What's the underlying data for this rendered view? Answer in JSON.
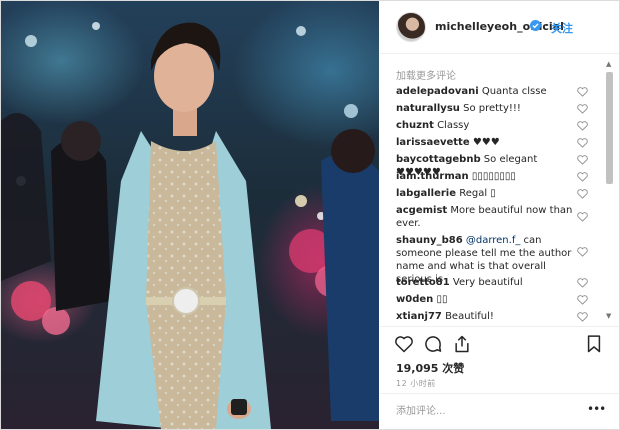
{
  "post": {
    "username": "michelleyeoh_official",
    "follow_label": "关注",
    "verified_color": "#3897f0"
  },
  "comments": {
    "load_more": "加载更多评论",
    "items": [
      {
        "user": "adelepadovani",
        "text": "Quanta clsse"
      },
      {
        "user": "naturallysu",
        "text": "So pretty!!!"
      },
      {
        "user": "chuznt",
        "text": "Classy"
      },
      {
        "user": "larissaevette",
        "text": "♥♥♥"
      },
      {
        "user": "baycottagebnb",
        "text": "So elegant ♥♥♥♥♥"
      },
      {
        "user": "iam.thurman",
        "text": "▯▯▯▯▯▯▯▯"
      },
      {
        "user": "labgallerie",
        "text": "Regal ▯"
      },
      {
        "user": "acgemist",
        "text": "More beautiful now than ever."
      },
      {
        "user": "shauny_b86",
        "mention": "@darren.f_",
        "text": "can someone please tell me the author name and what is that overall serious is"
      },
      {
        "user": "toretto81",
        "text": "Very beautiful"
      },
      {
        "user": "w0den",
        "text": "▯▯"
      },
      {
        "user": "xtianj77",
        "text": "Beautiful!"
      }
    ]
  },
  "actions": {
    "likes": "19,095 次赞",
    "time": "12 小时前",
    "add_comment_placeholder": "添加评论...",
    "more": "•••"
  },
  "colors": {
    "accent": "#3897f0",
    "muted": "#999999",
    "border": "#dbdbdb"
  },
  "icons": [
    "heart-icon",
    "comment-icon",
    "share-icon",
    "bookmark-icon",
    "verified-badge-icon",
    "more-options-icon"
  ]
}
